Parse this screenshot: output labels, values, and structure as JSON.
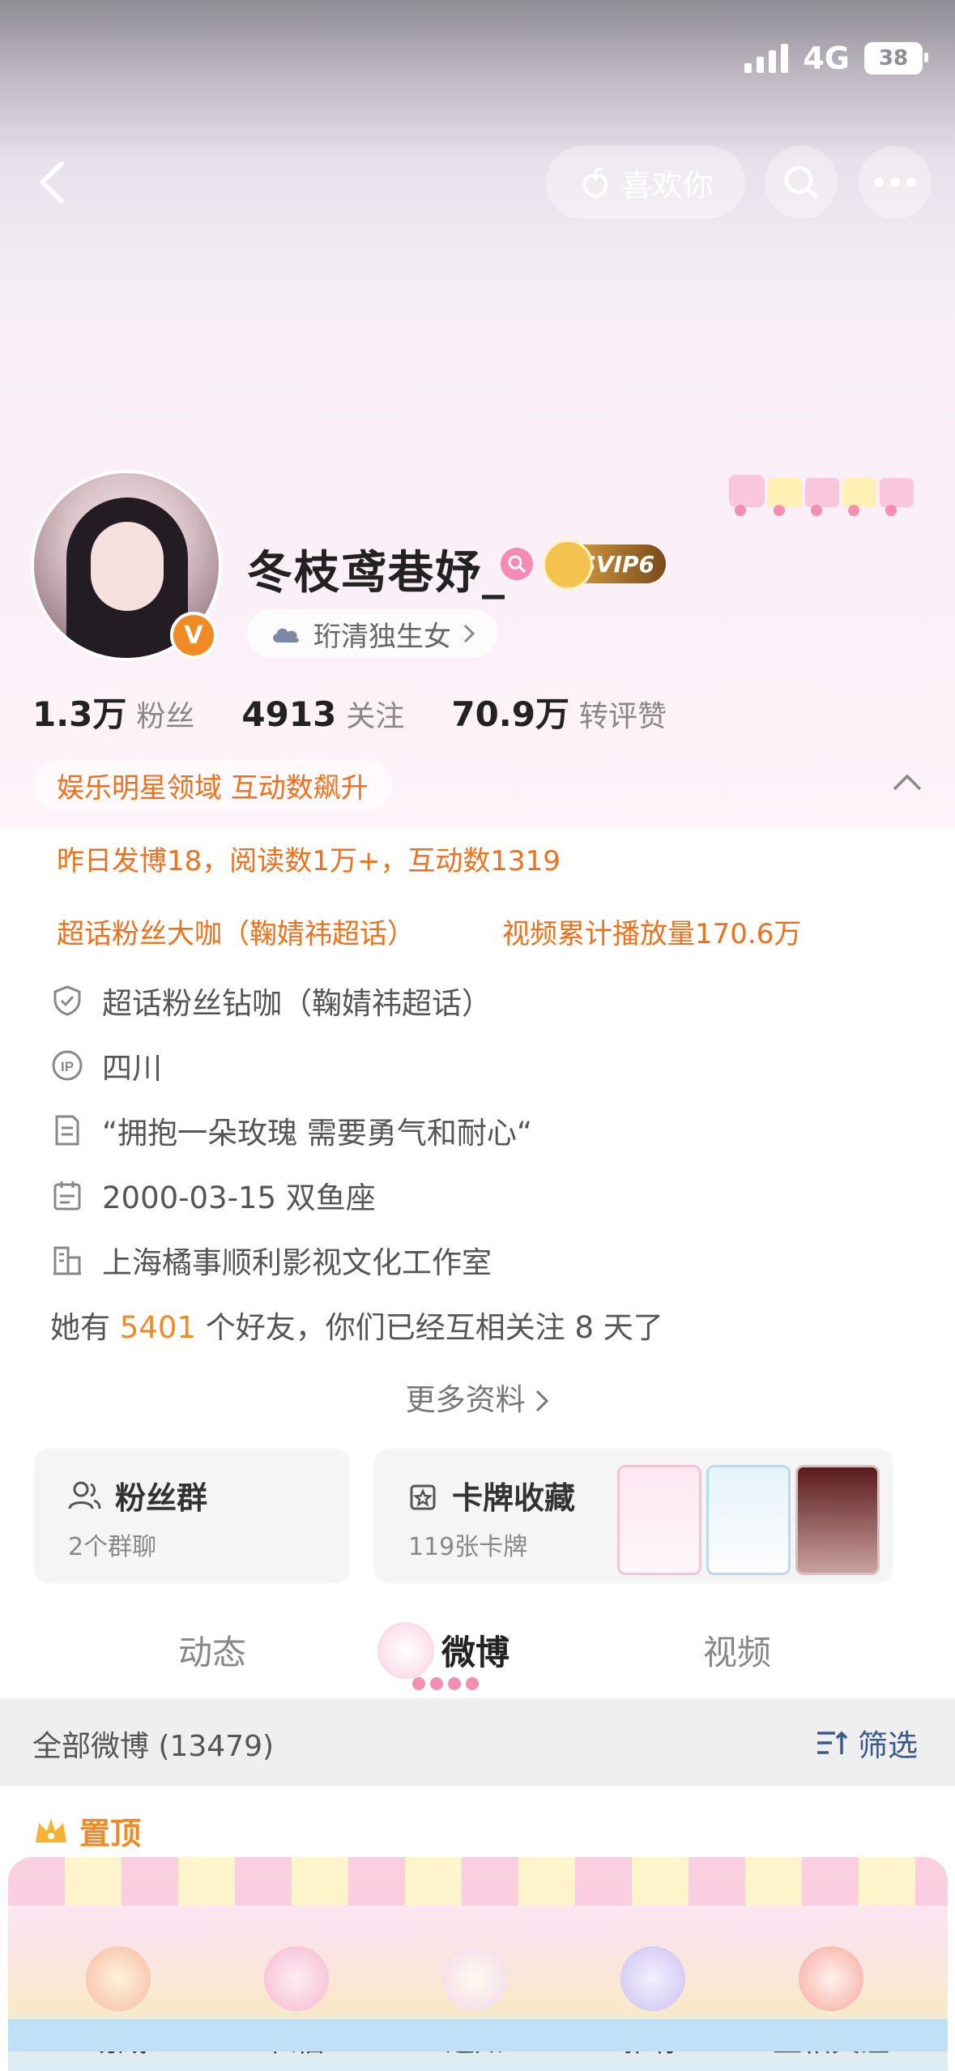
{
  "status_bar": {
    "network": "4G",
    "battery": "38"
  },
  "top_bar": {
    "like_label": "喜欢你"
  },
  "profile": {
    "username": "冬枝鸢巷妤_",
    "verified_mark": "V",
    "svip_label": "SVIP6",
    "group_tag": "珩清独生女",
    "stats": [
      {
        "num": "1.3万",
        "label": "粉丝"
      },
      {
        "num": "4913",
        "label": "关注"
      },
      {
        "num": "70.9万",
        "label": "转评赞"
      }
    ],
    "honors": {
      "field": "娱乐明星领域 互动数飙升",
      "yesterday": "昨日发博18，阅读数1万+，互动数1319",
      "superfan": "超话粉丝大咖（鞠婧祎超话）",
      "video": "视频累计播放量170.6万"
    },
    "info": [
      {
        "icon": "shield-icon",
        "text": "超话粉丝钻咖（鞠婧祎超话）"
      },
      {
        "icon": "ip-icon",
        "text": "四川"
      },
      {
        "icon": "document-icon",
        "text": "“拥抱一朵玫瑰 需要勇气和耐心“"
      },
      {
        "icon": "calendar-icon",
        "text": "2000-03-15 双鱼座"
      },
      {
        "icon": "building-icon",
        "text": "上海橘事顺利影视文化工作室"
      }
    ],
    "friends": {
      "prefix": "她有",
      "count": "5401",
      "suffix": "个好友，你们已经互相关注 8 天了"
    },
    "more_label": "更多资料"
  },
  "cards": {
    "fans_group": {
      "title": "粉丝群",
      "sub": "2个群聊"
    },
    "card_collection": {
      "title": "卡牌收藏",
      "sub": "119张卡牌"
    }
  },
  "tabs": [
    "动态",
    "微博",
    "视频"
  ],
  "feed": {
    "all_label": "全部微博 (13479)",
    "filter_label": "筛选",
    "pinned_label": "置顶"
  },
  "bottom_nav": [
    "助威",
    "私信",
    "通知",
    "推荐",
    "互相关注"
  ],
  "colors": {
    "accent": "#f08a24",
    "honor_text": "#f0701b",
    "filter_blue": "#3a5a8c"
  }
}
